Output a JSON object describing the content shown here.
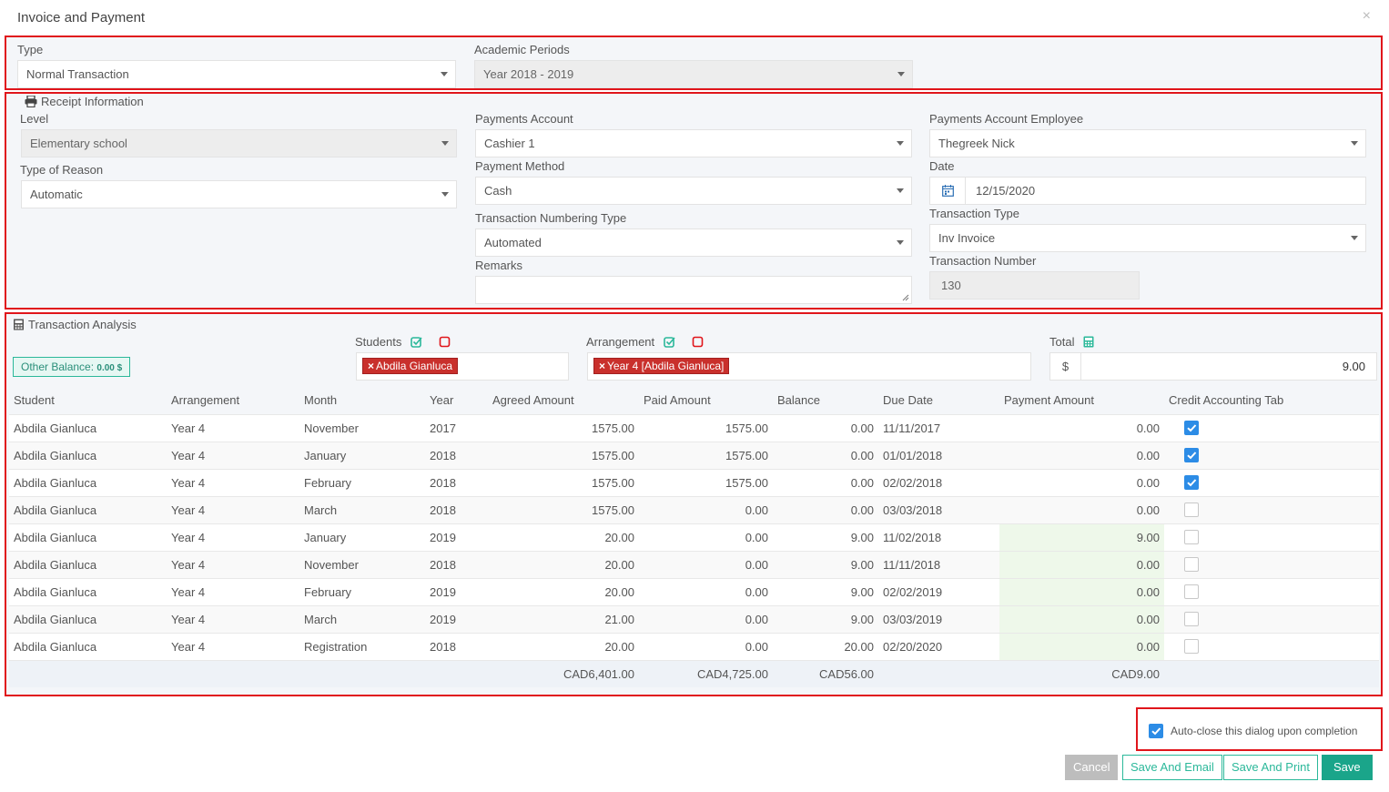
{
  "dialog": {
    "title": "Invoice and Payment",
    "close": "×"
  },
  "top": {
    "type_label": "Type",
    "type_value": "Normal Transaction",
    "period_label": "Academic Periods",
    "period_value": "Year 2018 - 2019"
  },
  "receipt": {
    "title": "Receipt Information",
    "level_label": "Level",
    "level_value": "Elementary school",
    "reason_label": "Type of Reason",
    "reason_value": "Automatic",
    "pay_account_label": "Payments Account",
    "pay_account_value": "Cashier 1",
    "pay_method_label": "Payment Method",
    "pay_method_value": "Cash",
    "numbering_label": "Transaction Numbering Type",
    "numbering_value": "Automated",
    "remarks_label": "Remarks",
    "employee_label": "Payments Account Employee",
    "employee_value": "Thegreek Nick",
    "date_label": "Date",
    "date_value": "12/15/2020",
    "ttype_label": "Transaction Type",
    "ttype_value": "Inv Invoice",
    "tnum_label": "Transaction Number",
    "tnum_value": "130"
  },
  "analysis": {
    "title": "Transaction Analysis",
    "other_balance_label": "Other Balance:",
    "other_balance_value": "0.00 $",
    "students_label": "Students",
    "students_tag": "Abdila Gianluca",
    "arrangement_label": "Arrangement",
    "arrangement_tag": "Year 4 [Abdila Gianluca]",
    "total_label": "Total",
    "total_currency": "$",
    "total_value": "9.00",
    "columns": [
      "Student",
      "Arrangement",
      "Month",
      "Year",
      "Agreed Amount",
      "Paid Amount",
      "Balance",
      "Due Date",
      "Payment Amount",
      "Credit Accounting Tab"
    ],
    "rows": [
      {
        "student": "Abdila Gianluca",
        "arrangement": "Year 4",
        "month": "November",
        "year": "2017",
        "agreed": "1575.00",
        "paid": "1575.00",
        "balance": "0.00",
        "due": "11/11/2017",
        "payment": "0.00",
        "editable": false,
        "checked": true
      },
      {
        "student": "Abdila Gianluca",
        "arrangement": "Year 4",
        "month": "January",
        "year": "2018",
        "agreed": "1575.00",
        "paid": "1575.00",
        "balance": "0.00",
        "due": "01/01/2018",
        "payment": "0.00",
        "editable": false,
        "checked": true
      },
      {
        "student": "Abdila Gianluca",
        "arrangement": "Year 4",
        "month": "February",
        "year": "2018",
        "agreed": "1575.00",
        "paid": "1575.00",
        "balance": "0.00",
        "due": "02/02/2018",
        "payment": "0.00",
        "editable": false,
        "checked": true
      },
      {
        "student": "Abdila Gianluca",
        "arrangement": "Year 4",
        "month": "March",
        "year": "2018",
        "agreed": "1575.00",
        "paid": "0.00",
        "balance": "0.00",
        "due": "03/03/2018",
        "payment": "0.00",
        "editable": false,
        "checked": false
      },
      {
        "student": "Abdila Gianluca",
        "arrangement": "Year 4",
        "month": "January",
        "year": "2019",
        "agreed": "20.00",
        "paid": "0.00",
        "balance": "9.00",
        "due": "11/02/2018",
        "payment": "9.00",
        "editable": true,
        "checked": false
      },
      {
        "student": "Abdila Gianluca",
        "arrangement": "Year 4",
        "month": "November",
        "year": "2018",
        "agreed": "20.00",
        "paid": "0.00",
        "balance": "9.00",
        "due": "11/11/2018",
        "payment": "0.00",
        "editable": true,
        "checked": false
      },
      {
        "student": "Abdila Gianluca",
        "arrangement": "Year 4",
        "month": "February",
        "year": "2019",
        "agreed": "20.00",
        "paid": "0.00",
        "balance": "9.00",
        "due": "02/02/2019",
        "payment": "0.00",
        "editable": true,
        "checked": false
      },
      {
        "student": "Abdila Gianluca",
        "arrangement": "Year 4",
        "month": "March",
        "year": "2019",
        "agreed": "21.00",
        "paid": "0.00",
        "balance": "9.00",
        "due": "03/03/2019",
        "payment": "0.00",
        "editable": true,
        "checked": false
      },
      {
        "student": "Abdila Gianluca",
        "arrangement": "Year 4",
        "month": "Registration",
        "year": "2018",
        "agreed": "20.00",
        "paid": "0.00",
        "balance": "20.00",
        "due": "02/20/2020",
        "payment": "0.00",
        "editable": true,
        "checked": false
      }
    ],
    "footer": {
      "agreed": "CAD6,401.00",
      "paid": "CAD4,725.00",
      "balance": "CAD56.00",
      "payment": "CAD9.00"
    }
  },
  "auto_close_label": "Auto-close this dialog upon completion",
  "buttons": {
    "cancel": "Cancel",
    "save_email": "Save And Email",
    "save_print": "Save And Print",
    "save": "Save"
  }
}
